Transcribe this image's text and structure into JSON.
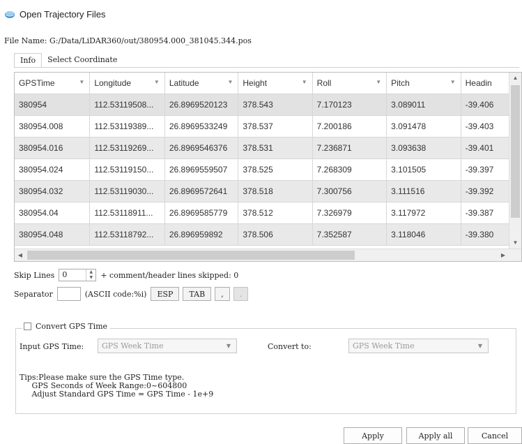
{
  "window": {
    "title": "Open Trajectory Files",
    "icon": "app-globe-icon"
  },
  "file_name": "File Name: G:/Data/LiDAR360/out/380954.000_381045.344.pos",
  "tabs": [
    {
      "label": "Info",
      "active": true
    },
    {
      "label": "Select Coordinate",
      "active": false
    }
  ],
  "table": {
    "columns": [
      "GPSTime",
      "Longitude",
      "Latitude",
      "Height",
      "Roll",
      "Pitch",
      "Headin"
    ],
    "rows": [
      [
        "380954",
        "112.53119508...",
        "26.8969520123",
        "378.543",
        "7.170123",
        "3.089011",
        "-39.406"
      ],
      [
        "380954.008",
        "112.53119389...",
        "26.8969533249",
        "378.537",
        "7.200186",
        "3.091478",
        "-39.403"
      ],
      [
        "380954.016",
        "112.53119269...",
        "26.8969546376",
        "378.531",
        "7.236871",
        "3.093638",
        "-39.401"
      ],
      [
        "380954.024",
        "112.53119150...",
        "26.8969559507",
        "378.525",
        "7.268309",
        "3.101505",
        "-39.397"
      ],
      [
        "380954.032",
        "112.53119030...",
        "26.8969572641",
        "378.518",
        "7.300756",
        "3.111516",
        "-39.392"
      ],
      [
        "380954.04",
        "112.53118911...",
        "26.8969585779",
        "378.512",
        "7.326979",
        "3.117972",
        "-39.387"
      ],
      [
        "380954.048",
        "112.53118792...",
        "26.896959892",
        "378.506",
        "7.352587",
        "3.118046",
        "-39.380"
      ]
    ]
  },
  "skip": {
    "label": "Skip Lines",
    "value": "0",
    "suffix": "+ comment/header lines skipped: 0"
  },
  "separator": {
    "label": "Separator",
    "ascii": "(ASCII code:%i)",
    "buttons": [
      "ESP",
      "TAB",
      ",",
      "."
    ]
  },
  "gps": {
    "checkbox_label": "Convert GPS Time",
    "checked": false,
    "input_label": "Input GPS Time:",
    "input_value": "GPS Week Time",
    "convert_label": "Convert to:",
    "convert_value": "GPS Week Time",
    "tips": "Tips:Please make sure the GPS Time type.\n     GPS Seconds of Week Range:0~604800\n     Adjust Standard GPS Time = GPS Time - 1e+9"
  },
  "buttons": {
    "apply": "Apply",
    "apply_all": "Apply all",
    "cancel": "Cancel"
  }
}
